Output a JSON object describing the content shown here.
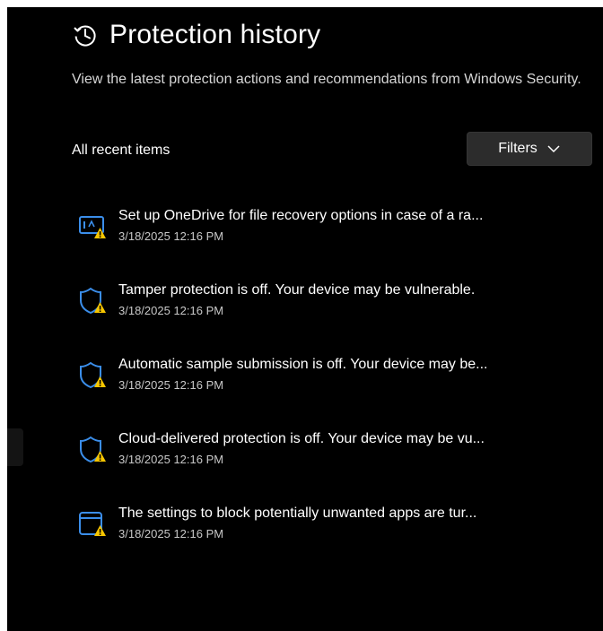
{
  "header": {
    "title": "Protection history",
    "description": "View the latest protection actions and recommendations from Windows Security."
  },
  "section_label": "All recent items",
  "filters": {
    "label": "Filters"
  },
  "items": [
    {
      "icon": "onedrive-warning-icon",
      "text": "Set up OneDrive for file recovery options in case of a ra...",
      "date": "3/18/2025 12:16 PM"
    },
    {
      "icon": "shield-warning-icon",
      "text": "Tamper protection is off. Your device may be vulnerable.",
      "date": "3/18/2025 12:16 PM"
    },
    {
      "icon": "shield-warning-icon",
      "text": "Automatic sample submission is off. Your device may be...",
      "date": "3/18/2025 12:16 PM"
    },
    {
      "icon": "shield-warning-icon",
      "text": "Cloud-delivered protection is off. Your device may be vu...",
      "date": "3/18/2025 12:16 PM"
    },
    {
      "icon": "app-browser-warning-icon",
      "text": "The settings to block potentially unwanted apps are tur...",
      "date": "3/18/2025 12:16 PM"
    }
  ],
  "colors": {
    "background": "#000000",
    "icon_blue": "#3b8eea",
    "warning_yellow": "#f7c600"
  }
}
